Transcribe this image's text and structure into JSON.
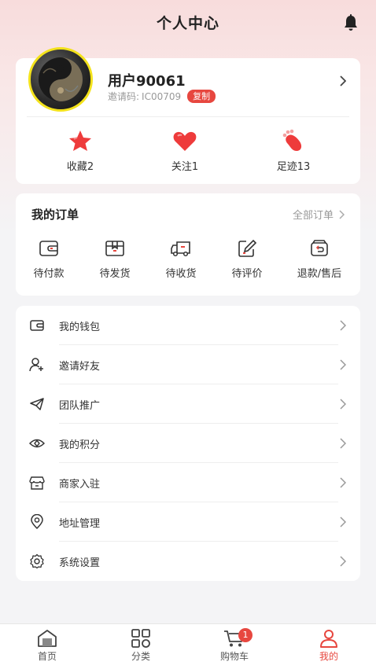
{
  "header": {
    "title": "个人中心",
    "bell_icon": "bell-icon"
  },
  "profile": {
    "username": "用户90061",
    "invite_label": "邀请码:",
    "invite_code": "IC00709",
    "copy_label": "复制",
    "stats": [
      {
        "icon": "star-icon",
        "label": "收藏2"
      },
      {
        "icon": "heart-icon",
        "label": "关注1"
      },
      {
        "icon": "footprint-icon",
        "label": "足迹13"
      }
    ]
  },
  "orders": {
    "title": "我的订单",
    "all_label": "全部订单",
    "items": [
      {
        "icon": "wallet-icon",
        "label": "待付款"
      },
      {
        "icon": "box-icon",
        "label": "待发货"
      },
      {
        "icon": "truck-icon",
        "label": "待收货"
      },
      {
        "icon": "pen-icon",
        "label": "待评价"
      },
      {
        "icon": "refund-icon",
        "label": "退款/售后"
      }
    ]
  },
  "menu": [
    {
      "icon": "wallet-icon",
      "label": "我的钱包"
    },
    {
      "icon": "add-user-icon",
      "label": "邀请好友"
    },
    {
      "icon": "paper-plane-icon",
      "label": "团队推广"
    },
    {
      "icon": "eye-diamond-icon",
      "label": "我的积分"
    },
    {
      "icon": "store-icon",
      "label": "商家入驻"
    },
    {
      "icon": "location-icon",
      "label": "地址管理"
    },
    {
      "icon": "settings-icon",
      "label": "系统设置"
    }
  ],
  "tabs": [
    {
      "icon": "home-icon",
      "label": "首页"
    },
    {
      "icon": "grid-icon",
      "label": "分类"
    },
    {
      "icon": "cart-icon",
      "label": "购物车",
      "badge": "1"
    },
    {
      "icon": "user-icon",
      "label": "我的"
    }
  ],
  "colors": {
    "accent": "#e7473f",
    "avatar_border": "#f3e21b",
    "header_bg": "#f8dcdc"
  }
}
